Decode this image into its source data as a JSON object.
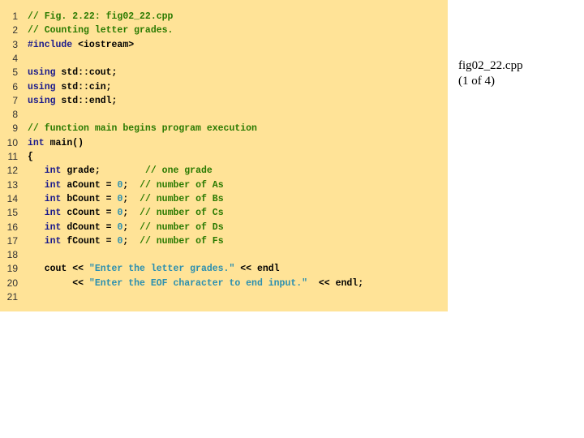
{
  "slide": {
    "file_label": "fig02_22.cpp",
    "page_label": "(1 of 4)"
  },
  "code": {
    "lines": [
      {
        "num": "1",
        "segments": [
          {
            "t": "// Fig. 2.22: fig02_22.cpp",
            "c": "cm"
          }
        ]
      },
      {
        "num": "2",
        "segments": [
          {
            "t": "// Counting letter grades.",
            "c": "cm"
          }
        ]
      },
      {
        "num": "3",
        "segments": [
          {
            "t": "#include",
            "c": "kw"
          },
          {
            "t": " <iostream>",
            "c": "pl"
          }
        ]
      },
      {
        "num": "4",
        "segments": []
      },
      {
        "num": "5",
        "segments": [
          {
            "t": "using",
            "c": "kw"
          },
          {
            "t": " std::cout;",
            "c": "pl"
          }
        ]
      },
      {
        "num": "6",
        "segments": [
          {
            "t": "using",
            "c": "kw"
          },
          {
            "t": " std::cin;",
            "c": "pl"
          }
        ]
      },
      {
        "num": "7",
        "segments": [
          {
            "t": "using",
            "c": "kw"
          },
          {
            "t": " std::endl;",
            "c": "pl"
          }
        ]
      },
      {
        "num": "8",
        "segments": []
      },
      {
        "num": "9",
        "segments": [
          {
            "t": "// function main begins program execution",
            "c": "cm"
          }
        ]
      },
      {
        "num": "10",
        "segments": [
          {
            "t": "int",
            "c": "kw"
          },
          {
            "t": " main()",
            "c": "pl"
          }
        ]
      },
      {
        "num": "11",
        "segments": [
          {
            "t": "{",
            "c": "pl"
          }
        ]
      },
      {
        "num": "12",
        "segments": [
          {
            "t": "   ",
            "c": "pl"
          },
          {
            "t": "int",
            "c": "kw"
          },
          {
            "t": " grade;        ",
            "c": "pl"
          },
          {
            "t": "// one grade",
            "c": "cm"
          }
        ]
      },
      {
        "num": "13",
        "segments": [
          {
            "t": "   ",
            "c": "pl"
          },
          {
            "t": "int",
            "c": "kw"
          },
          {
            "t": " aCount = ",
            "c": "pl"
          },
          {
            "t": "0",
            "c": "nm"
          },
          {
            "t": ";  ",
            "c": "pl"
          },
          {
            "t": "// number of As",
            "c": "cm"
          }
        ]
      },
      {
        "num": "14",
        "segments": [
          {
            "t": "   ",
            "c": "pl"
          },
          {
            "t": "int",
            "c": "kw"
          },
          {
            "t": " bCount = ",
            "c": "pl"
          },
          {
            "t": "0",
            "c": "nm"
          },
          {
            "t": ";  ",
            "c": "pl"
          },
          {
            "t": "// number of Bs",
            "c": "cm"
          }
        ]
      },
      {
        "num": "15",
        "segments": [
          {
            "t": "   ",
            "c": "pl"
          },
          {
            "t": "int",
            "c": "kw"
          },
          {
            "t": " cCount = ",
            "c": "pl"
          },
          {
            "t": "0",
            "c": "nm"
          },
          {
            "t": ";  ",
            "c": "pl"
          },
          {
            "t": "// number of Cs",
            "c": "cm"
          }
        ]
      },
      {
        "num": "16",
        "segments": [
          {
            "t": "   ",
            "c": "pl"
          },
          {
            "t": "int",
            "c": "kw"
          },
          {
            "t": " dCount = ",
            "c": "pl"
          },
          {
            "t": "0",
            "c": "nm"
          },
          {
            "t": ";  ",
            "c": "pl"
          },
          {
            "t": "// number of Ds",
            "c": "cm"
          }
        ]
      },
      {
        "num": "17",
        "segments": [
          {
            "t": "   ",
            "c": "pl"
          },
          {
            "t": "int",
            "c": "kw"
          },
          {
            "t": " fCount = ",
            "c": "pl"
          },
          {
            "t": "0",
            "c": "nm"
          },
          {
            "t": ";  ",
            "c": "pl"
          },
          {
            "t": "// number of Fs",
            "c": "cm"
          }
        ]
      },
      {
        "num": "18",
        "segments": []
      },
      {
        "num": "19",
        "segments": [
          {
            "t": "   cout << ",
            "c": "pl"
          },
          {
            "t": "\"Enter the letter grades.\"",
            "c": "st"
          },
          {
            "t": " << endl",
            "c": "pl"
          }
        ]
      },
      {
        "num": "20",
        "segments": [
          {
            "t": "        << ",
            "c": "pl"
          },
          {
            "t": "\"Enter the EOF character to end input.\"",
            "c": "st"
          },
          {
            "t": "  << endl;",
            "c": "pl"
          }
        ]
      },
      {
        "num": "21",
        "segments": []
      }
    ]
  }
}
